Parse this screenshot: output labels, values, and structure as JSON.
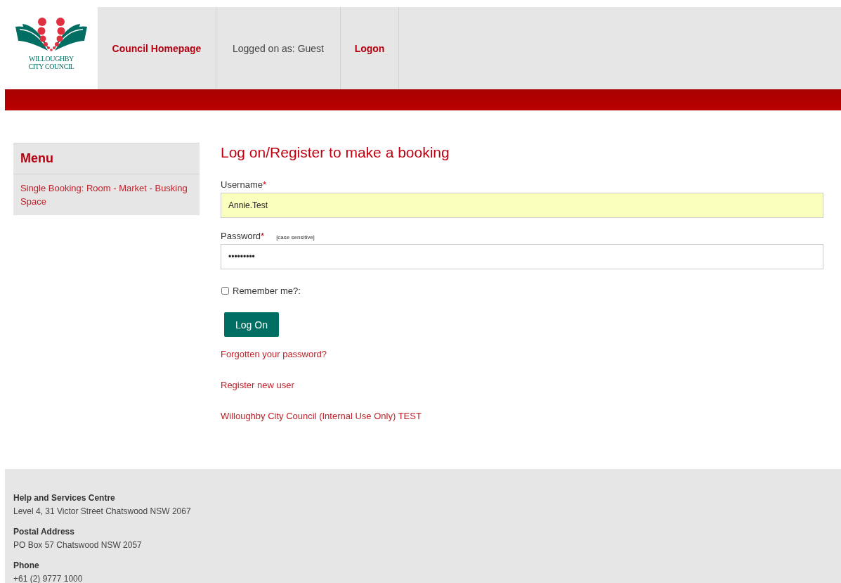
{
  "logo": {
    "lines": [
      "WILLOUGHBY",
      "CITY COUNCIL"
    ]
  },
  "nav": [
    {
      "kind": "link",
      "label": "Council Homepage"
    },
    {
      "kind": "text",
      "label": "Logged on as: Guest"
    },
    {
      "kind": "link",
      "label": "Logon"
    }
  ],
  "sidebar": {
    "title": "Menu",
    "items": [
      {
        "label": "Single Booking: Room - Market - Busking Space"
      }
    ]
  },
  "form": {
    "title": "Log on/Register to make a booking",
    "fields": [
      {
        "label": "Username",
        "required_mark": "*",
        "value": "Annie.Test",
        "autofilled": true
      },
      {
        "label": "Password",
        "required_mark": "*",
        "hint": "[case sensitive]",
        "value": "•••••••••",
        "autofilled": false
      }
    ],
    "remember": {
      "label": "Remember me?:",
      "checked": false
    },
    "button": "Log On",
    "links": [
      "Forgotten your password?",
      "Register new user",
      "Willoughby City Council (Internal Use Only) TEST"
    ]
  },
  "footer": [
    {
      "heading": "Help and Services Centre",
      "text": "Level 4, 31 Victor Street Chatswood NSW 2067"
    },
    {
      "heading": "Postal Address",
      "text": "PO Box 57 Chatswood NSW 2057"
    },
    {
      "heading": "Phone",
      "text": "+61 (2) 9777 1000"
    }
  ]
}
